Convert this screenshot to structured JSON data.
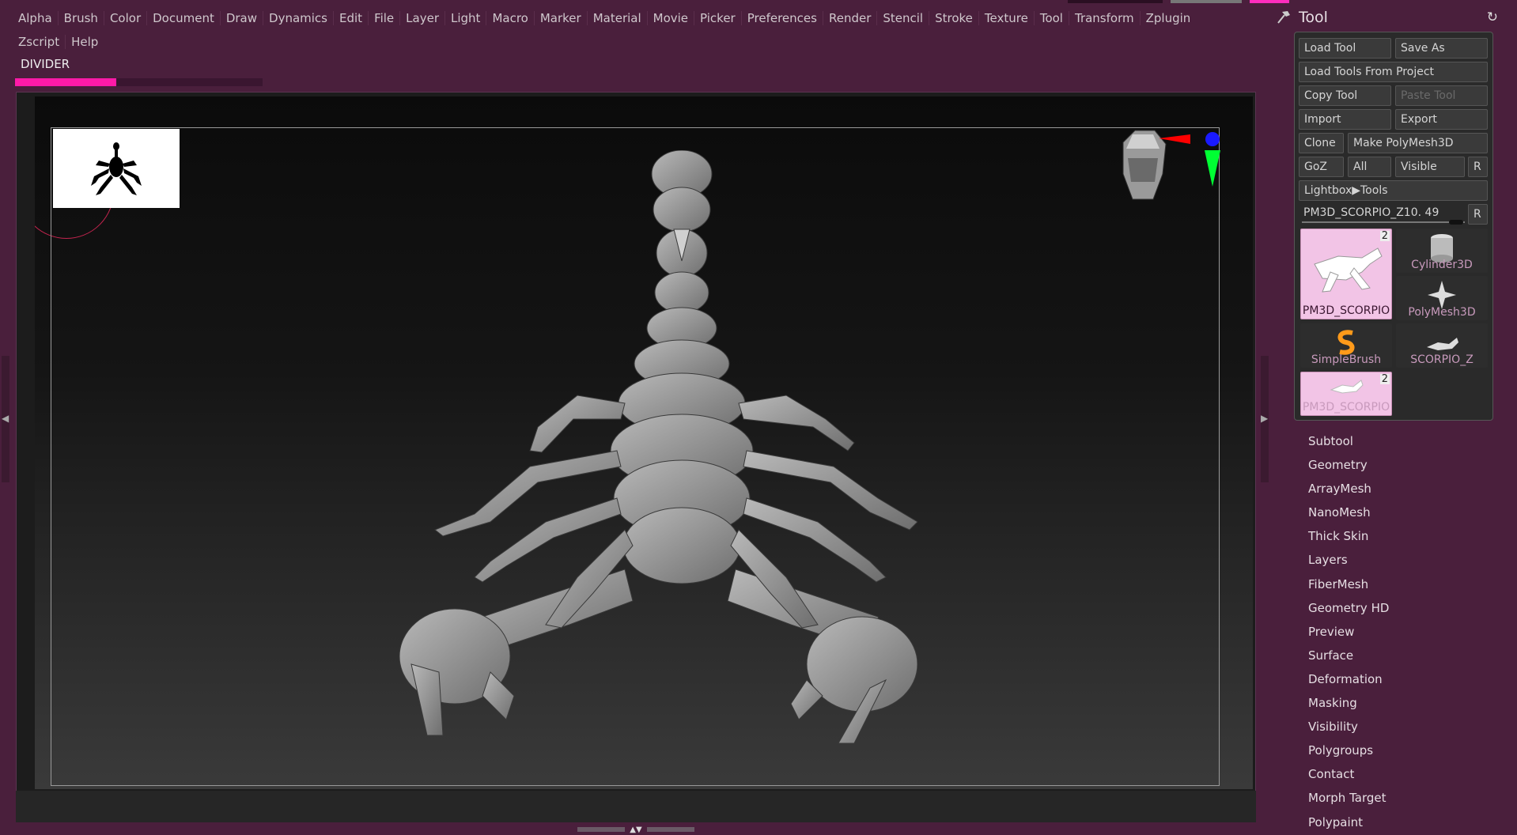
{
  "menus": {
    "row1": [
      "Alpha",
      "Brush",
      "Color",
      "Document",
      "Draw",
      "Dynamics",
      "Edit",
      "File",
      "Layer",
      "Light",
      "Macro",
      "Marker",
      "Material",
      "Movie",
      "Picker",
      "Preferences",
      "Render",
      "Stencil",
      "Stroke",
      "Texture",
      "Tool",
      "Transform",
      "Zplugin"
    ],
    "row2": [
      "Zscript",
      "Help"
    ]
  },
  "status": {
    "label": "DIVIDER",
    "progress": 0.41
  },
  "colors": {
    "accent": "#ff1aa8",
    "background": "#4a1f3c",
    "panel": "#2a2a2a"
  },
  "tool_panel": {
    "title": "Tool",
    "reset_icon": "refresh-icon",
    "buttons": {
      "load_tool": "Load Tool",
      "save_as": "Save As",
      "load_tools_from_project": "Load Tools From Project",
      "copy_tool": "Copy Tool",
      "paste_tool": "Paste Tool",
      "import": "Import",
      "export": "Export",
      "clone": "Clone",
      "make_polymesh": "Make PolyMesh3D",
      "goz": "GoZ",
      "all": "All",
      "visible": "Visible",
      "r1": "R",
      "lightbox_tools": "Lightbox▶Tools",
      "r2": "R"
    },
    "slider": {
      "label": "PM3D_SCORPIO_Z10.",
      "value": "49"
    },
    "tiles": [
      {
        "label": "PM3D_SCORPIO",
        "badge": "2"
      },
      {
        "label": "Cylinder3D"
      },
      {
        "label": "PolyMesh3D"
      },
      {
        "label": "SimpleBrush"
      },
      {
        "label": "SCORPIO_Z"
      },
      {
        "label": "PM3D_SCORPIO",
        "badge": "2"
      }
    ],
    "sections": [
      "Subtool",
      "Geometry",
      "ArrayMesh",
      "NanoMesh",
      "Thick Skin",
      "Layers",
      "FiberMesh",
      "Geometry HD",
      "Preview",
      "Surface",
      "Deformation",
      "Masking",
      "Visibility",
      "Polygroups",
      "Contact",
      "Morph Target",
      "Polypaint"
    ]
  }
}
